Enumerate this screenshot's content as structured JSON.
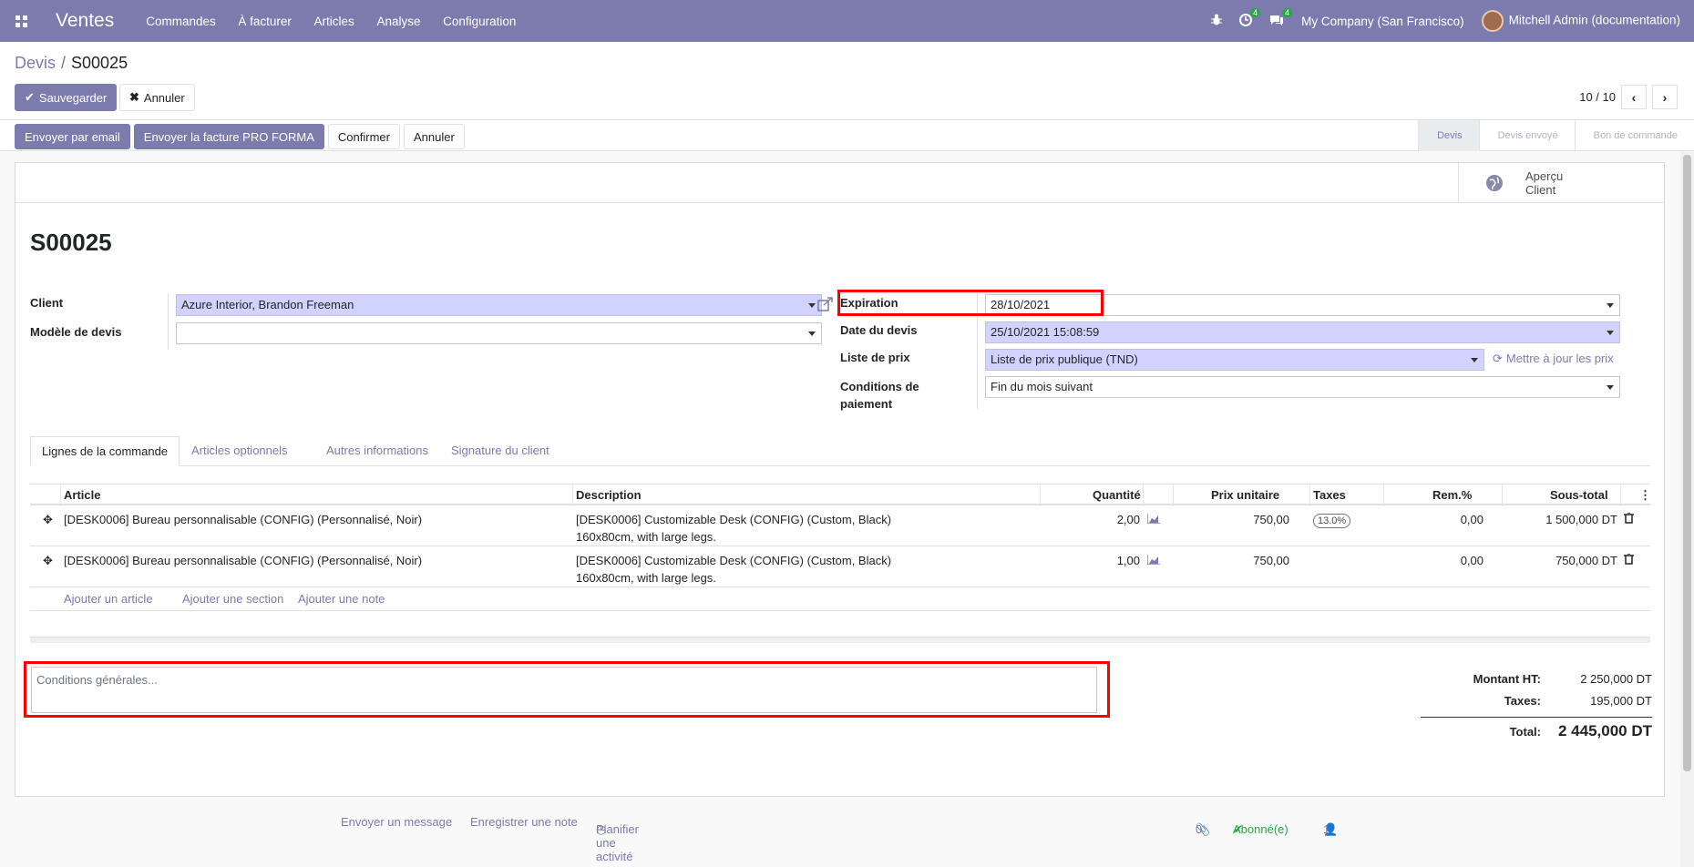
{
  "topbar": {
    "app_name": "Ventes",
    "menu": [
      "Commandes",
      "À facturer",
      "Articles",
      "Analyse",
      "Configuration"
    ],
    "activity_count": "4",
    "message_count": "4",
    "company": "My Company (San Francisco)",
    "user": "Mitchell Admin (documentation)"
  },
  "breadcrumb": {
    "parent": "Devis",
    "current": "S00025"
  },
  "actions": {
    "save": "Sauvegarder",
    "discard": "Annuler"
  },
  "pager": {
    "value": "10 / 10"
  },
  "status_buttons": {
    "email": "Envoyer par email",
    "proforma": "Envoyer la facture PRO FORMA",
    "confirm": "Confirmer",
    "cancel": "Annuler"
  },
  "stages": [
    {
      "label": "Devis",
      "active": true
    },
    {
      "label": "Devis envoyé",
      "active": false
    },
    {
      "label": "Bon de commande",
      "active": false
    }
  ],
  "preview_button": {
    "line1": "Aperçu",
    "line2": "Client"
  },
  "record": {
    "name": "S00025",
    "client_label": "Client",
    "client_value": "Azure Interior, Brandon Freeman",
    "template_label": "Modèle de devis",
    "template_value": "",
    "expiration_label": "Expiration",
    "expiration_value": "28/10/2021",
    "date_label": "Date du devis",
    "date_value": "25/10/2021 15:08:59",
    "pricelist_label": "Liste de prix",
    "pricelist_value": "Liste de prix publique (TND)",
    "update_prices": "Mettre à jour les prix",
    "payment_label_1": "Conditions de",
    "payment_label_2": "paiement",
    "payment_value": "Fin du mois suivant"
  },
  "tabs": [
    "Lignes de la commande",
    "Articles optionnels",
    "Autres informations",
    "Signature du client"
  ],
  "lines": {
    "headers": {
      "article": "Article",
      "description": "Description",
      "quantity": "Quantité",
      "unit_price": "Prix unitaire",
      "taxes": "Taxes",
      "discount": "Rem.%",
      "subtotal": "Sous-total"
    },
    "rows": [
      {
        "article": "[DESK0006] Bureau personnalisable (CONFIG) (Personnalisé, Noir)",
        "desc1": "[DESK0006] Customizable Desk (CONFIG) (Custom, Black)",
        "desc2": "160x80cm, with large legs.",
        "qty": "2,00",
        "price": "750,00",
        "tax": "13.0%",
        "disc": "0,00",
        "subtotal": "1 500,000 DT"
      },
      {
        "article": "[DESK0006] Bureau personnalisable (CONFIG) (Personnalisé, Noir)",
        "desc1": "[DESK0006] Customizable Desk (CONFIG) (Custom, Black)",
        "desc2": "160x80cm, with large legs.",
        "qty": "1,00",
        "price": "750,00",
        "tax": "",
        "disc": "0,00",
        "subtotal": "750,000 DT"
      }
    ],
    "add_product": "Ajouter un article",
    "add_section": "Ajouter une section",
    "add_note": "Ajouter une note"
  },
  "terms_placeholder": "Conditions générales...",
  "totals": {
    "untaxed_label": "Montant HT:",
    "untaxed": "2 250,000 DT",
    "taxes_label": "Taxes:",
    "taxes": "195,000 DT",
    "total_label": "Total:",
    "total": "2 445,000 DT"
  },
  "chatter": {
    "send_message": "Envoyer un message",
    "log_note": "Enregistrer une note",
    "schedule": "Planifier une activité",
    "attachments": "0",
    "following": "Abonné(e)",
    "followers": "1"
  },
  "colors": {
    "brand": "#7c7bad",
    "required_field": "#d2d2ff",
    "highlight": "#ff0000",
    "success": "#28a745"
  }
}
